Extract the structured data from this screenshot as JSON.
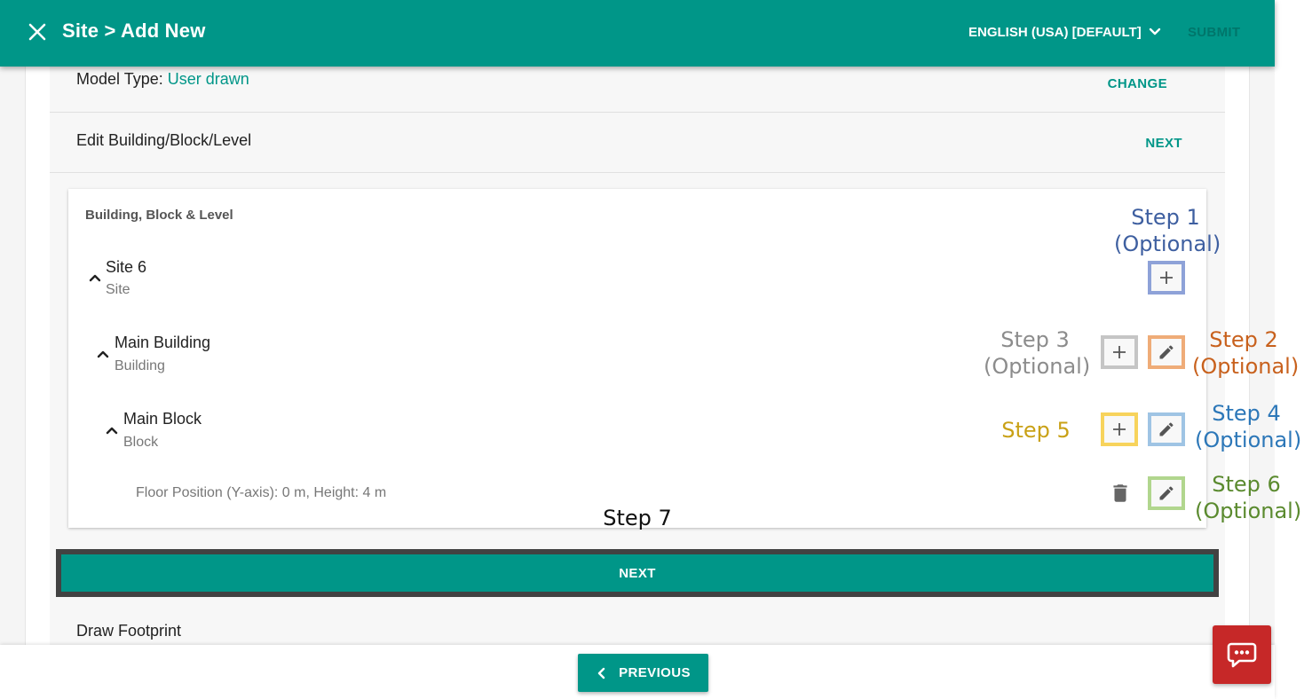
{
  "header": {
    "title": "Site > Add New",
    "language": "ENGLISH (USA) [DEFAULT]",
    "submit_label": "SUBMIT"
  },
  "model_row": {
    "label": "Model Type",
    "separator": ": ",
    "value": "User drawn",
    "action": "CHANGE"
  },
  "edit_row": {
    "label": "Edit Building/Block/Level",
    "action": "NEXT"
  },
  "card": {
    "heading": "Building, Block & Level",
    "nodes": [
      {
        "name": "Site 6",
        "type": "Site"
      },
      {
        "name": "Main Building",
        "type": "Building"
      },
      {
        "name": "Main Block",
        "type": "Block"
      }
    ],
    "floor": "Floor Position (Y-axis): 0 m, Height: 4 m"
  },
  "steps": {
    "step1": {
      "title": "Step 1",
      "note": "(Optional)",
      "color": "#3e5fa0"
    },
    "step2": {
      "title": "Step 2",
      "note": "(Optional)",
      "color": "#c8611d"
    },
    "step3": {
      "title": "Step 3",
      "note": "(Optional)",
      "color": "#8c8c8c"
    },
    "step4": {
      "title": "Step 4",
      "note": "(Optional)",
      "color": "#2c77b8"
    },
    "step5": {
      "title": "Step 5",
      "color": "#c9a116"
    },
    "step6": {
      "title": "Step 6",
      "note": "(Optional)",
      "color": "#5a8a2e"
    },
    "step7": {
      "title": "Step 7",
      "color": "#111111"
    }
  },
  "box_colors": {
    "step1": "#8ea2d8",
    "step2": "#efac78",
    "step3": "#c5c5c5",
    "step4": "#9fc4e4",
    "step5": "#f7d35c",
    "step6": "#b1d68e"
  },
  "next_button": "NEXT",
  "footprint_row": {
    "label": "Draw Footprint"
  },
  "previous_button": "PREVIOUS",
  "icons": [
    "close-icon",
    "chevron-down-icon",
    "chevron-up-icon",
    "plus-icon",
    "pencil-icon",
    "trash-icon",
    "chevron-left-icon",
    "chat-icon"
  ],
  "colors": {
    "primary": "#009688",
    "chat": "#c62828"
  }
}
